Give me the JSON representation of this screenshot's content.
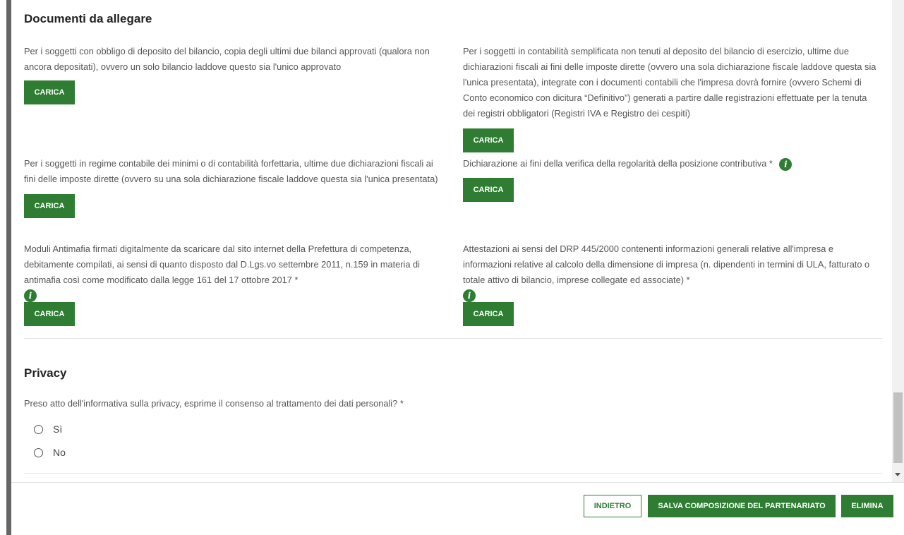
{
  "documents": {
    "title": "Documenti da allegare",
    "upload_label": "CARICA",
    "items": [
      {
        "text": "Per i soggetti con obbligo di deposito del bilancio, copia degli ultimi due bilanci approvati (qualora non ancora depositati), ovvero un solo bilancio laddove questo sia l'unico approvato"
      },
      {
        "text": "Per i soggetti in contabilità semplificata non tenuti al deposito del bilancio di esercizio, ultime due dichiarazioni fiscali ai fini delle imposte dirette (ovvero una sola dichiarazione fiscale laddove questa sia l'unica presentata), integrate con i documenti contabili che l'impresa dovrà fornire (ovvero Schemi di Conto economico con dicitura “Definitivo”) generati a partire dalle registrazioni effettuate per la tenuta dei registri obbligatori (Registri IVA e Registro dei cespiti)"
      },
      {
        "text": "Per i soggetti in regime contabile dei minimi o di contabilità forfettaria, ultime due dichiarazioni fiscali ai fini delle imposte dirette (ovvero su una sola dichiarazione fiscale laddove questa sia l'unica presentata)"
      },
      {
        "text": "Dichiarazione ai fini della verifica della regolarità della posizione contributiva *"
      },
      {
        "text": "Moduli Antimafia firmati digitalmente da scaricare dal sito internet della Prefettura di competenza, debitamente compilati, ai sensi di quanto disposto dal D.Lgs.vo settembre 2011, n.159 in materia di antimafia così come modificato dalla legge 161 del 17 ottobre 2017 *"
      },
      {
        "text": "Attestazioni ai sensi del DRP 445/2000 contenenti informazioni generali relative all'impresa e informazioni relative al calcolo della dimensione di impresa (n. dipendenti in termini di ULA, fatturato o totale attivo di bilancio, imprese collegate ed associate) *"
      }
    ],
    "info_glyph": "i"
  },
  "privacy": {
    "title": "Privacy",
    "question": "Preso atto dell'informativa sulla privacy, esprime il consenso al trattamento dei dati personali? *",
    "options": [
      "Sì",
      "No"
    ]
  },
  "footer": {
    "back_label": "INDIETRO",
    "save_label": "SALVA COMPOSIZIONE DEL PARTENARIATO",
    "delete_label": "ELIMINA"
  },
  "colors": {
    "accent": "#2e7d32"
  }
}
